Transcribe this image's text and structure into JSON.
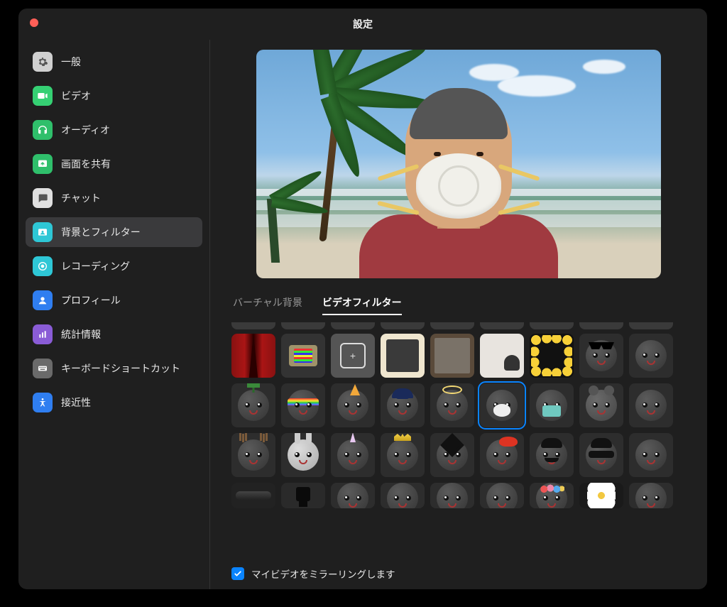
{
  "window": {
    "title": "設定"
  },
  "sidebar": {
    "items": [
      {
        "label": "一般",
        "icon": "gear-icon",
        "color": "#d0d0d0",
        "fg": "#555",
        "selected": false
      },
      {
        "label": "ビデオ",
        "icon": "video-icon",
        "color": "#35d073",
        "fg": "#fff",
        "selected": false
      },
      {
        "label": "オーディオ",
        "icon": "headphones-icon",
        "color": "#2fbf6b",
        "fg": "#fff",
        "selected": false
      },
      {
        "label": "画面を共有",
        "icon": "share-screen-icon",
        "color": "#2fbf6b",
        "fg": "#fff",
        "selected": false
      },
      {
        "label": "チャット",
        "icon": "chat-icon",
        "color": "#e0e0e0",
        "fg": "#555",
        "selected": false
      },
      {
        "label": "背景とフィルター",
        "icon": "background-filters-icon",
        "color": "#2ec7d6",
        "fg": "#fff",
        "selected": true
      },
      {
        "label": "レコーディング",
        "icon": "record-icon",
        "color": "#2ec7d6",
        "fg": "#fff",
        "selected": false
      },
      {
        "label": "プロフィール",
        "icon": "profile-icon",
        "color": "#2f7ef0",
        "fg": "#fff",
        "selected": false
      },
      {
        "label": "統計情報",
        "icon": "stats-icon",
        "color": "#8a5cd6",
        "fg": "#fff",
        "selected": false
      },
      {
        "label": "キーボードショートカット",
        "icon": "keyboard-icon",
        "color": "#6a6a6a",
        "fg": "#fff",
        "selected": false
      },
      {
        "label": "接近性",
        "icon": "accessibility-icon",
        "color": "#2f7ef0",
        "fg": "#fff",
        "selected": false
      }
    ]
  },
  "tabs": {
    "virtual_background": "バーチャル背景",
    "video_filters": "ビデオフィルター",
    "active": "video_filters"
  },
  "mirror": {
    "label": "マイビデオをミラーリングします",
    "checked": true
  },
  "filters": {
    "selected": "mask-n95",
    "row1": [
      {
        "id": "theater-frame",
        "kind": "theater"
      },
      {
        "id": "retro-tv",
        "kind": "tv"
      },
      {
        "id": "focus-reticle",
        "kind": "focus"
      },
      {
        "id": "cream-frame",
        "kind": "frame1"
      },
      {
        "id": "wood-frame",
        "kind": "frame2"
      },
      {
        "id": "room-silhouette",
        "kind": "room"
      },
      {
        "id": "emoji-frame",
        "kind": "emoji"
      },
      {
        "id": "pixel-sunglasses",
        "kind": "sunglasses"
      },
      {
        "id": "placeholder-1",
        "kind": "face-basic"
      }
    ],
    "row2": [
      {
        "id": "sprout",
        "kind": "face",
        "deco": "sprout"
      },
      {
        "id": "rainbow",
        "kind": "face",
        "deco": "rainbow"
      },
      {
        "id": "party-hat",
        "kind": "face",
        "deco": "partyhat"
      },
      {
        "id": "baseball-cap",
        "kind": "face",
        "deco": "cap"
      },
      {
        "id": "angel-halo",
        "kind": "face",
        "deco": "halo"
      },
      {
        "id": "mask-n95",
        "kind": "face",
        "deco": "n95"
      },
      {
        "id": "mask-surgical",
        "kind": "face",
        "deco": "surg"
      },
      {
        "id": "mouse-ears",
        "kind": "face",
        "deco": "mouse"
      },
      {
        "id": "placeholder-2",
        "kind": "face-basic"
      }
    ],
    "row3": [
      {
        "id": "reindeer-antlers",
        "kind": "face",
        "deco": "antler"
      },
      {
        "id": "bunny-ears",
        "kind": "face",
        "deco": "bunny"
      },
      {
        "id": "unicorn-horn",
        "kind": "face",
        "deco": "unicorn"
      },
      {
        "id": "royal-crown",
        "kind": "face",
        "deco": "royal"
      },
      {
        "id": "graduation-cap",
        "kind": "face",
        "deco": "grad"
      },
      {
        "id": "red-beret",
        "kind": "face",
        "deco": "beret"
      },
      {
        "id": "mustache-bowler",
        "kind": "face",
        "deco": "stache"
      },
      {
        "id": "bandit-mask",
        "kind": "face",
        "deco": "bandit"
      },
      {
        "id": "placeholder-3",
        "kind": "face-basic"
      }
    ],
    "row4": [
      {
        "id": "pirate-hat",
        "kind": "pirate"
      },
      {
        "id": "top-hat",
        "kind": "tophat"
      },
      {
        "id": "dark-face-1",
        "kind": "face-basic"
      },
      {
        "id": "dark-face-2",
        "kind": "face-basic"
      },
      {
        "id": "dark-face-3",
        "kind": "face-basic"
      },
      {
        "id": "dark-face-4",
        "kind": "face-basic"
      },
      {
        "id": "flower-crown",
        "kind": "face",
        "deco": "flowers"
      },
      {
        "id": "daisy-flower",
        "kind": "daisy"
      },
      {
        "id": "placeholder-4",
        "kind": "face-basic"
      }
    ]
  }
}
